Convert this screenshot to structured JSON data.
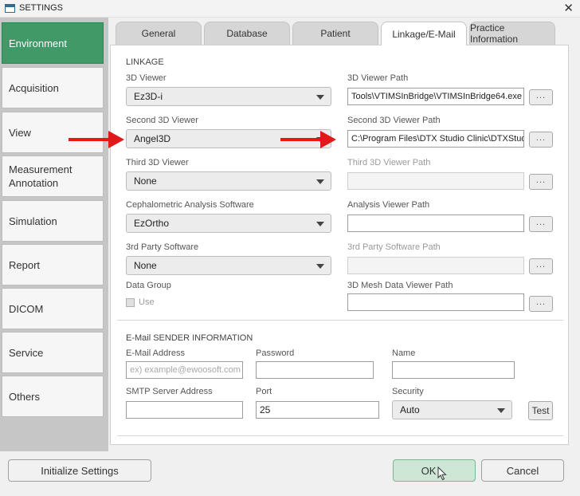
{
  "window": {
    "title": "SETTINGS",
    "close_glyph": "✕"
  },
  "sidebar": {
    "items": [
      {
        "label": "Environment",
        "active": true
      },
      {
        "label": "Acquisition"
      },
      {
        "label": "View"
      },
      {
        "label": "Measurement Annotation"
      },
      {
        "label": "Simulation"
      },
      {
        "label": "Report"
      },
      {
        "label": "DICOM"
      },
      {
        "label": "Service"
      },
      {
        "label": "Others"
      }
    ]
  },
  "tabs": [
    {
      "label": "General"
    },
    {
      "label": "Database"
    },
    {
      "label": "Patient"
    },
    {
      "label": "Linkage/E-Mail",
      "active": true
    },
    {
      "label": "Practice Information"
    }
  ],
  "linkage": {
    "section_title": "LINKAGE",
    "viewer_3d": {
      "label": "3D Viewer",
      "value": "Ez3D-i"
    },
    "viewer_3d_path": {
      "label": "3D Viewer Path",
      "value": "Tools\\VTIMSInBridge\\VTIMSInBridge64.exe"
    },
    "second_viewer": {
      "label": "Second 3D Viewer",
      "value": "Angel3D"
    },
    "second_viewer_path": {
      "label": "Second 3D Viewer Path",
      "value": "C:\\Program Files\\DTX Studio Clinic\\DTXStudio"
    },
    "third_viewer": {
      "label": "Third 3D Viewer",
      "value": "None"
    },
    "third_viewer_path": {
      "label": "Third 3D Viewer Path",
      "value": ""
    },
    "ceph_software": {
      "label": "Cephalometric Analysis Software",
      "value": "EzOrtho"
    },
    "analysis_viewer_path": {
      "label": "Analysis Viewer Path",
      "value": ""
    },
    "third_party": {
      "label": "3rd Party Software",
      "value": "None"
    },
    "third_party_path": {
      "label": "3rd Party Software Path",
      "value": ""
    },
    "data_group": {
      "label": "Data Group",
      "use_label": "Use",
      "checked": false
    },
    "mesh_viewer_path": {
      "label": "3D Mesh Data Viewer Path",
      "value": ""
    },
    "browse_label": "..."
  },
  "email": {
    "section_title": "E-Mail SENDER INFORMATION",
    "address": {
      "label": "E-Mail Address",
      "placeholder": "ex) example@ewoosoft.com"
    },
    "password": {
      "label": "Password",
      "value": ""
    },
    "name": {
      "label": "Name",
      "value": ""
    },
    "smtp": {
      "label": "SMTP Server Address",
      "value": ""
    },
    "port": {
      "label": "Port",
      "value": "25"
    },
    "security": {
      "label": "Security",
      "value": "Auto"
    },
    "test_label": "Test"
  },
  "footer": {
    "initialize_label": "Initialize Settings",
    "ok_label": "OK",
    "cancel_label": "Cancel"
  },
  "colors": {
    "active_green": "#3f9a67",
    "arrow_red": "#e0191b",
    "ok_green": "#cde6d5"
  }
}
